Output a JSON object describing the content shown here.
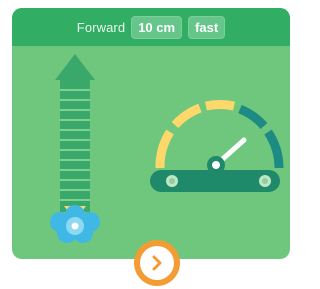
{
  "header": {
    "label": "Forward",
    "distance_value": "10 cm",
    "speed_value": "fast"
  },
  "colors": {
    "card_background": "#6fc77e",
    "header_background": "#31ad64",
    "arrow": "#3aa86a",
    "speed_arc_yellow": "#ffd86b",
    "speed_arc_teal": "#1e8a84",
    "needle": "#ffffff",
    "gauge_base": "#1f8a6a",
    "robot": "#3fb8e5",
    "next_button": "#f39c33"
  },
  "icons": {
    "distance": "up-arrow-icon",
    "speed": "speedometer-icon",
    "robot": "robot-icon",
    "next": "chevron-right-icon"
  }
}
